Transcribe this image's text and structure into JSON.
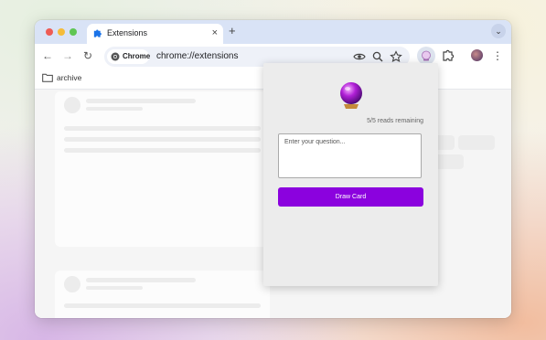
{
  "browser": {
    "tab": {
      "title": "Extensions",
      "close_glyph": "×",
      "icon": "puzzle-icon"
    },
    "new_tab_glyph": "+",
    "tab_search_glyph": "⌄",
    "nav": {
      "back": "←",
      "forward": "→",
      "reload": "↻"
    },
    "omnibox": {
      "chip_label": "Chrome",
      "url": "chrome://extensions"
    },
    "toolbar_icons": [
      "eye-icon",
      "zoom-icon",
      "star-icon",
      "extension-icon",
      "puzzle-icon",
      "avatar",
      "menu-icon"
    ],
    "menu_glyph": "⋮"
  },
  "bookmarks": [
    {
      "label": "archive",
      "icon": "folder-icon"
    }
  ],
  "popup": {
    "icon": "crystal-ball-icon",
    "reads_remaining": "5/5 reads remaining",
    "question_placeholder": "Enter your question...",
    "question_value": "",
    "draw_button": "Draw Card",
    "accent": "#8b02de"
  }
}
